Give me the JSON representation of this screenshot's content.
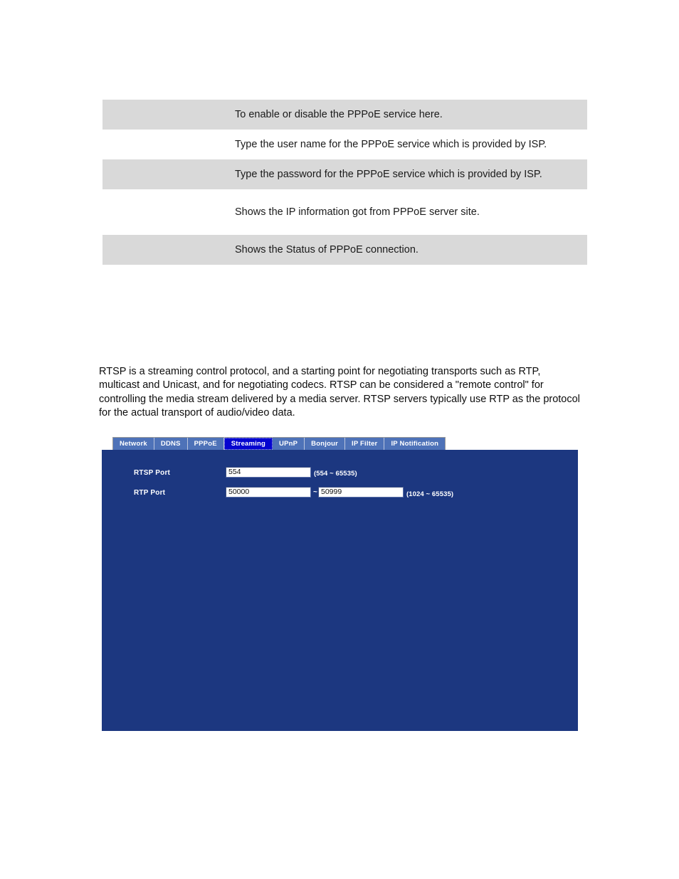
{
  "doc": {
    "table": {
      "rows": [
        {
          "term": "",
          "description": "To enable or disable the PPPoE service here."
        },
        {
          "term": "",
          "description": "Type the user name for the PPPoE service which is provided by ISP."
        },
        {
          "term": "",
          "description": "Type the password for the PPPoE service which is provided by ISP."
        },
        {
          "term": "",
          "description": "Shows the IP information got from PPPoE server site."
        },
        {
          "term": "",
          "description": "Shows the Status of PPPoE connection."
        }
      ]
    },
    "paragraph": "RTSP is a streaming control protocol, and a starting point for negotiating transports such as RTP, multicast and Unicast, and for negotiating codecs. RTSP can be considered a \"remote control\" for controlling the media stream delivered by a media server. RTSP servers typically use RTP as the protocol for the actual transport of audio/video data."
  },
  "device_ui": {
    "tabs": [
      {
        "label": "Network",
        "active": false
      },
      {
        "label": "DDNS",
        "active": false
      },
      {
        "label": "PPPoE",
        "active": false
      },
      {
        "label": "Streaming",
        "active": true
      },
      {
        "label": "UPnP",
        "active": false
      },
      {
        "label": "Bonjour",
        "active": false
      },
      {
        "label": "IP Filter",
        "active": false
      },
      {
        "label": "IP Notification",
        "active": false
      }
    ],
    "form": {
      "rtsp_port": {
        "label": "RTSP Port",
        "value": "554",
        "placeholder": "",
        "range_hint": "(554 ~ 65535)"
      },
      "rtp_port": {
        "label": "RTP Port",
        "value_start": "50000",
        "separator": "~",
        "value_end": "50999",
        "placeholder": "",
        "range_hint": "(1024 ~ 65535)"
      }
    },
    "colors": {
      "panel_background": "#1c3780",
      "tab_inactive": "#4e72b8",
      "tab_active": "#0505cf",
      "tab_text": "#ffffff"
    }
  }
}
